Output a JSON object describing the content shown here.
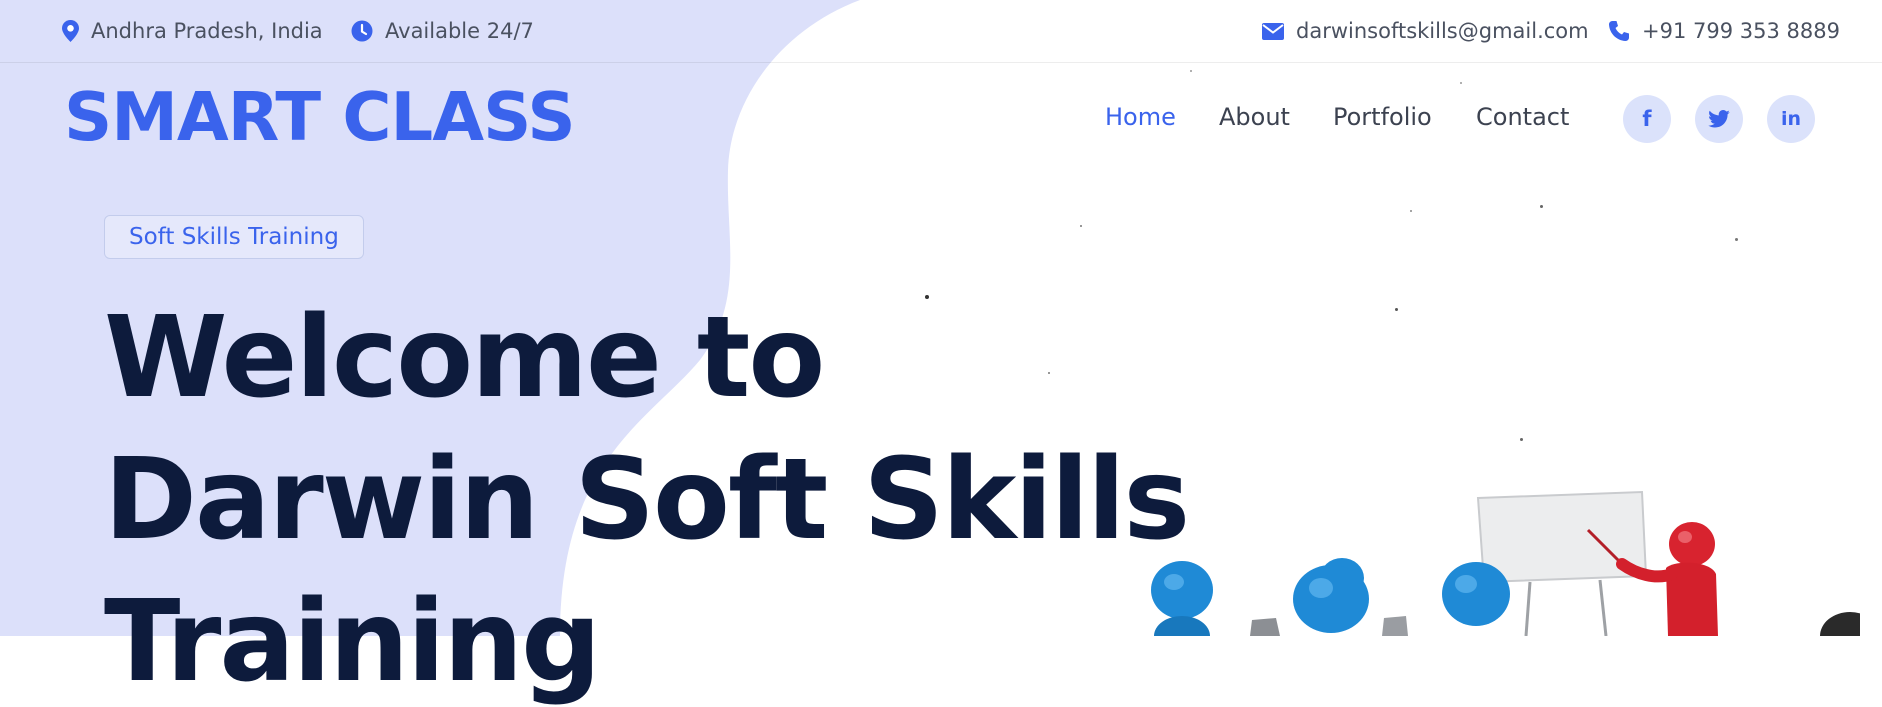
{
  "topbar": {
    "location": {
      "icon": "map-pin-icon",
      "text": "Andhra Pradesh, India"
    },
    "hours": {
      "icon": "clock-icon",
      "text": "Available 24/7"
    },
    "email": {
      "icon": "envelope-icon",
      "text": "darwinsoftskills@gmail.com"
    },
    "phone": {
      "icon": "phone-icon",
      "text": "+91 799 353 8889"
    }
  },
  "brand": {
    "name": "SMART CLASS"
  },
  "nav": {
    "items": [
      {
        "label": "Home",
        "active": true
      },
      {
        "label": "About",
        "active": false
      },
      {
        "label": "Portfolio",
        "active": false
      },
      {
        "label": "Contact",
        "active": false
      }
    ]
  },
  "social": [
    {
      "icon": "facebook-icon",
      "text": "f"
    },
    {
      "icon": "twitter-icon",
      "text": ""
    },
    {
      "icon": "linkedin-icon",
      "text": "in"
    }
  ],
  "hero": {
    "badge": "Soft Skills Training",
    "title_line1": "Welcome to",
    "title_line2": "Darwin Soft Skills",
    "title_line3": "Training"
  },
  "colors": {
    "accent": "#3a63ec",
    "heading": "#0d1b3c",
    "blob": "#dce0fa",
    "social_bg": "#dbe2fb"
  },
  "illustration": {
    "icon": "classroom-presentation-illustration"
  }
}
